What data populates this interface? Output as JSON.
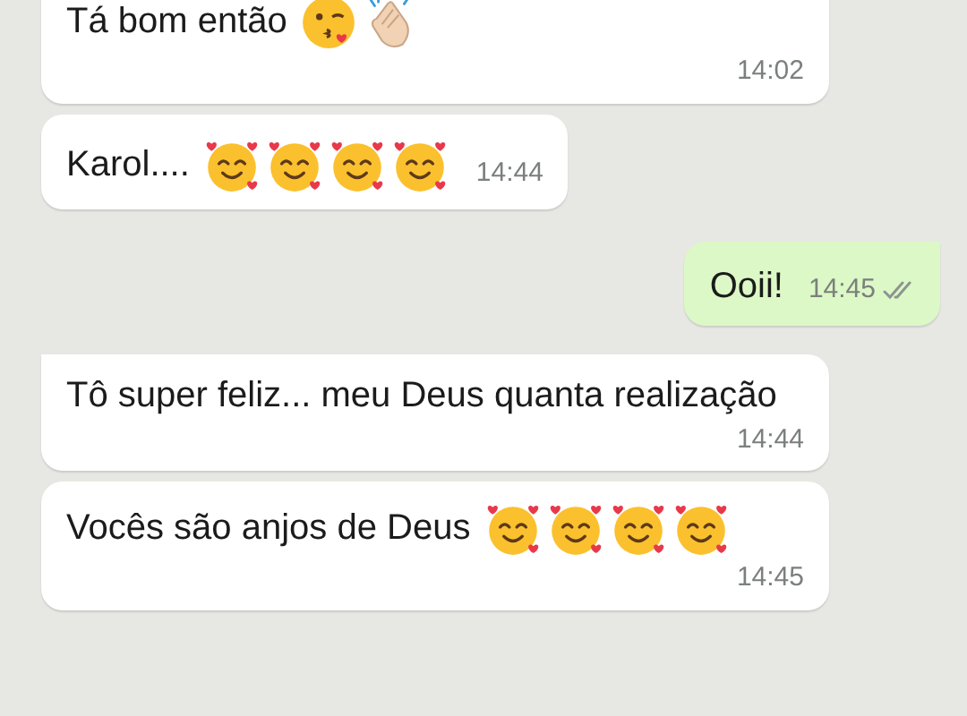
{
  "messages": [
    {
      "outgoing": false,
      "kind": "wide",
      "text": "Tá bom então",
      "emojis": [
        {
          "kind": "kiss_face"
        },
        {
          "kind": "clapping_hands"
        }
      ],
      "time": "14:02"
    },
    {
      "outgoing": false,
      "kind": "compact",
      "text": "Karol....",
      "emojis": [
        {
          "kind": "hearts_face"
        },
        {
          "kind": "hearts_face"
        },
        {
          "kind": "hearts_face"
        },
        {
          "kind": "hearts_face"
        }
      ],
      "time": "14:44"
    },
    {
      "outgoing": true,
      "kind": "compact",
      "text": "Ooii!",
      "time": "14:45",
      "read": false,
      "tail": true
    },
    {
      "outgoing": false,
      "kind": "wide",
      "text": "Tô super feliz... meu Deus quanta realização",
      "time": "14:44",
      "tail": true
    },
    {
      "outgoing": false,
      "kind": "wide",
      "text": "Vocês são anjos de Deus",
      "emojis": [
        {
          "kind": "hearts_face"
        },
        {
          "kind": "hearts_face"
        },
        {
          "kind": "hearts_face"
        },
        {
          "kind": "hearts_face"
        }
      ],
      "time": "14:45"
    }
  ]
}
